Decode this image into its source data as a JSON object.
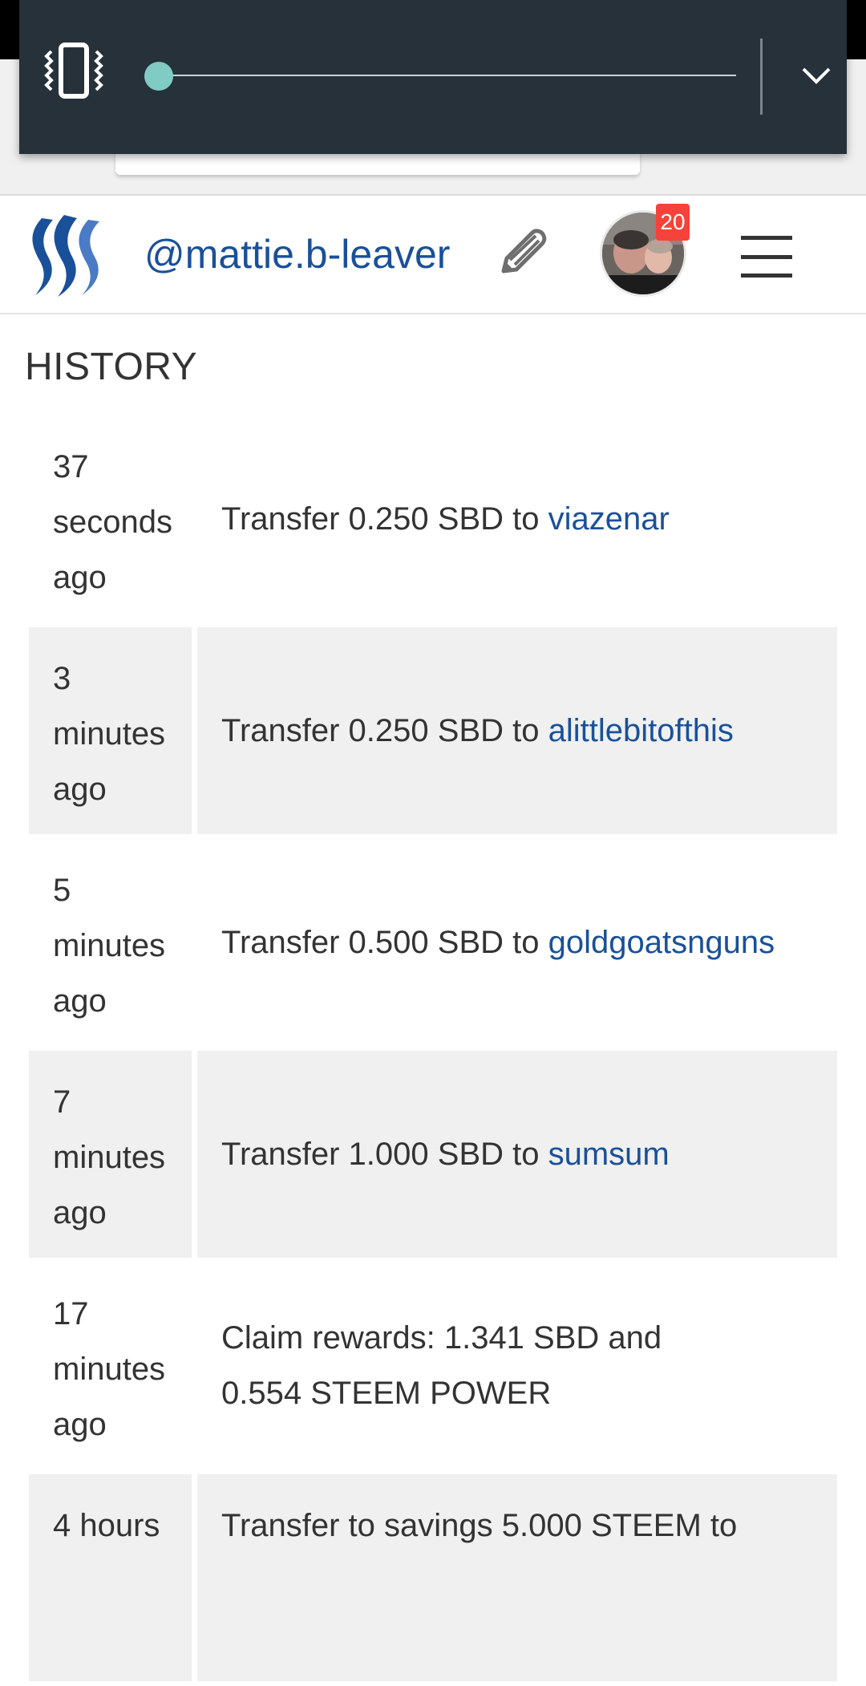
{
  "header": {
    "username": "@mattie.b-leaver",
    "notification_count": "20"
  },
  "history": {
    "title": "HISTORY",
    "rows": [
      {
        "time": [
          "37",
          "seconds",
          "ago"
        ],
        "text": "Transfer 0.250 SBD to ",
        "link": "viazenar"
      },
      {
        "time": [
          "3",
          "minutes",
          "ago"
        ],
        "text": "Transfer 0.250 SBD to ",
        "link": "alittlebitofthis"
      },
      {
        "time": [
          "5",
          "minutes",
          "ago"
        ],
        "text": "Transfer 0.500 SBD to ",
        "link": "goldgoatsnguns"
      },
      {
        "time": [
          "7",
          "minutes",
          "ago"
        ],
        "text": "Transfer 1.000 SBD to ",
        "link": "sumsum"
      },
      {
        "time": [
          "17",
          "minutes",
          "ago"
        ],
        "text": "Claim rewards: 1.341 SBD and 0.554 STEEM POWER",
        "link": ""
      },
      {
        "time": [
          "4 hours"
        ],
        "text": "Transfer to savings 5.000 STEEM to",
        "link": ""
      }
    ]
  },
  "volume": {
    "level": 0.0,
    "accent_color": "#80cbc4"
  },
  "colors": {
    "link": "#1a5099",
    "badge": "#f4433b",
    "row_shade": "#f0f0f0"
  }
}
